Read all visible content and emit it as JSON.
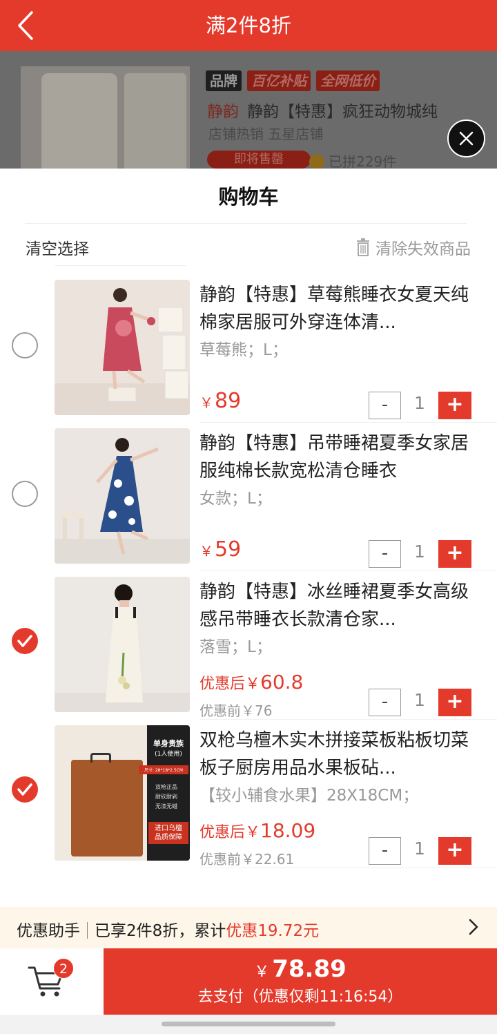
{
  "header": {
    "title": "满2件8折"
  },
  "background_product": {
    "tags": [
      "品牌",
      "百亿补贴",
      "全网低价"
    ],
    "brand": "静韵",
    "name": "静韵【特惠】疯狂动物城纯",
    "subtitle": "店铺热销  五星店铺",
    "soon_label": "即将售罄",
    "grouped": "已拼229件"
  },
  "cart": {
    "title": "购物车",
    "clear_selection": "清空选择",
    "clear_invalid": "清除失效商品",
    "items": [
      {
        "title": "静韵【特惠】草莓熊睡衣女夏天纯棉家居服可外穿连体清...",
        "spec": "草莓熊；L；",
        "price": "89",
        "qty": "1",
        "checked": false
      },
      {
        "title": "静韵【特惠】吊带睡裙夏季女家居服纯棉长款宽松清仓睡衣",
        "spec": "女款；L；",
        "price": "59",
        "qty": "1",
        "checked": false
      },
      {
        "title": "静韵【特惠】冰丝睡裙夏季女高级感吊带睡衣长款清仓家...",
        "spec": "落雪；L；",
        "after_label": "优惠后",
        "after_price": "60.8",
        "before": "优惠前￥76",
        "qty": "1",
        "checked": true
      },
      {
        "title": "双枪乌檀木实木拼接菜板粘板切菜板子厨房用品水果板砧...",
        "spec": "【较小辅食水果】28X18CM；",
        "after_label": "优惠后",
        "after_price": "18.09",
        "before": "优惠前￥22.61",
        "qty": "1",
        "checked": true,
        "image_text": {
          "headline": "单身贵族",
          "sub": "(1人使用)",
          "size": "尺寸: 28*18*2.5CM",
          "features": [
            "双枪正品",
            "耐砍耐剁",
            "无漆无蜡"
          ],
          "guarantee": "进口乌檀\n品质保障"
        }
      }
    ]
  },
  "helper": {
    "label": "优惠助手",
    "text_prefix": "已享2件8折，累计",
    "highlight": "优惠19.72元"
  },
  "footer": {
    "cart_badge": "2",
    "currency": "￥",
    "total": "78.89",
    "pay_label": "去支付（优惠仅剩11:16:54）"
  },
  "colors": {
    "accent": "#e43a2c",
    "helper_bg": "#fdf6e9"
  }
}
